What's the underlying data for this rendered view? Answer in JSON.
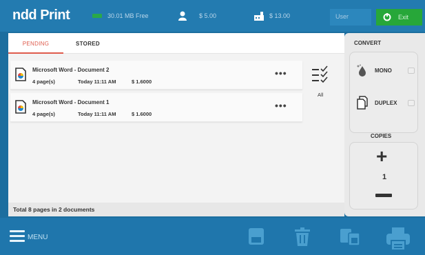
{
  "header": {
    "logo": "ndd Print",
    "storage_free": "30.01 MB Free",
    "user_balance": "$ 5.00",
    "quota_balance": "$ 13.00",
    "user_label": "User",
    "exit_label": "Exit"
  },
  "tabs": [
    {
      "label": "PENDING",
      "active": true
    },
    {
      "label": "STORED",
      "active": false
    }
  ],
  "jobs": [
    {
      "title": "Microsoft Word - Document 2",
      "pages": "4 page(s)",
      "time": "Today 11:11 AM",
      "cost": "$ 1.6000"
    },
    {
      "title": "Microsoft Word - Document 1",
      "pages": "4 page(s)",
      "time": "Today 11:11 AM",
      "cost": "$ 1.6000"
    }
  ],
  "select_all_label": "All",
  "summary": "Total 8 pages in 2 documents",
  "side_panel": {
    "convert_title": "CONVERT",
    "mono_label": "MONO",
    "duplex_label": "DUPLEX",
    "copies_title": "COPIES",
    "copies_value": "1"
  },
  "bottom": {
    "menu_label": "MENU"
  },
  "colors": {
    "header_bg": "#237bb0",
    "bottom_bg": "#1f76ac",
    "accent_pending": "#de5a4b",
    "exit_green": "#27a739"
  }
}
